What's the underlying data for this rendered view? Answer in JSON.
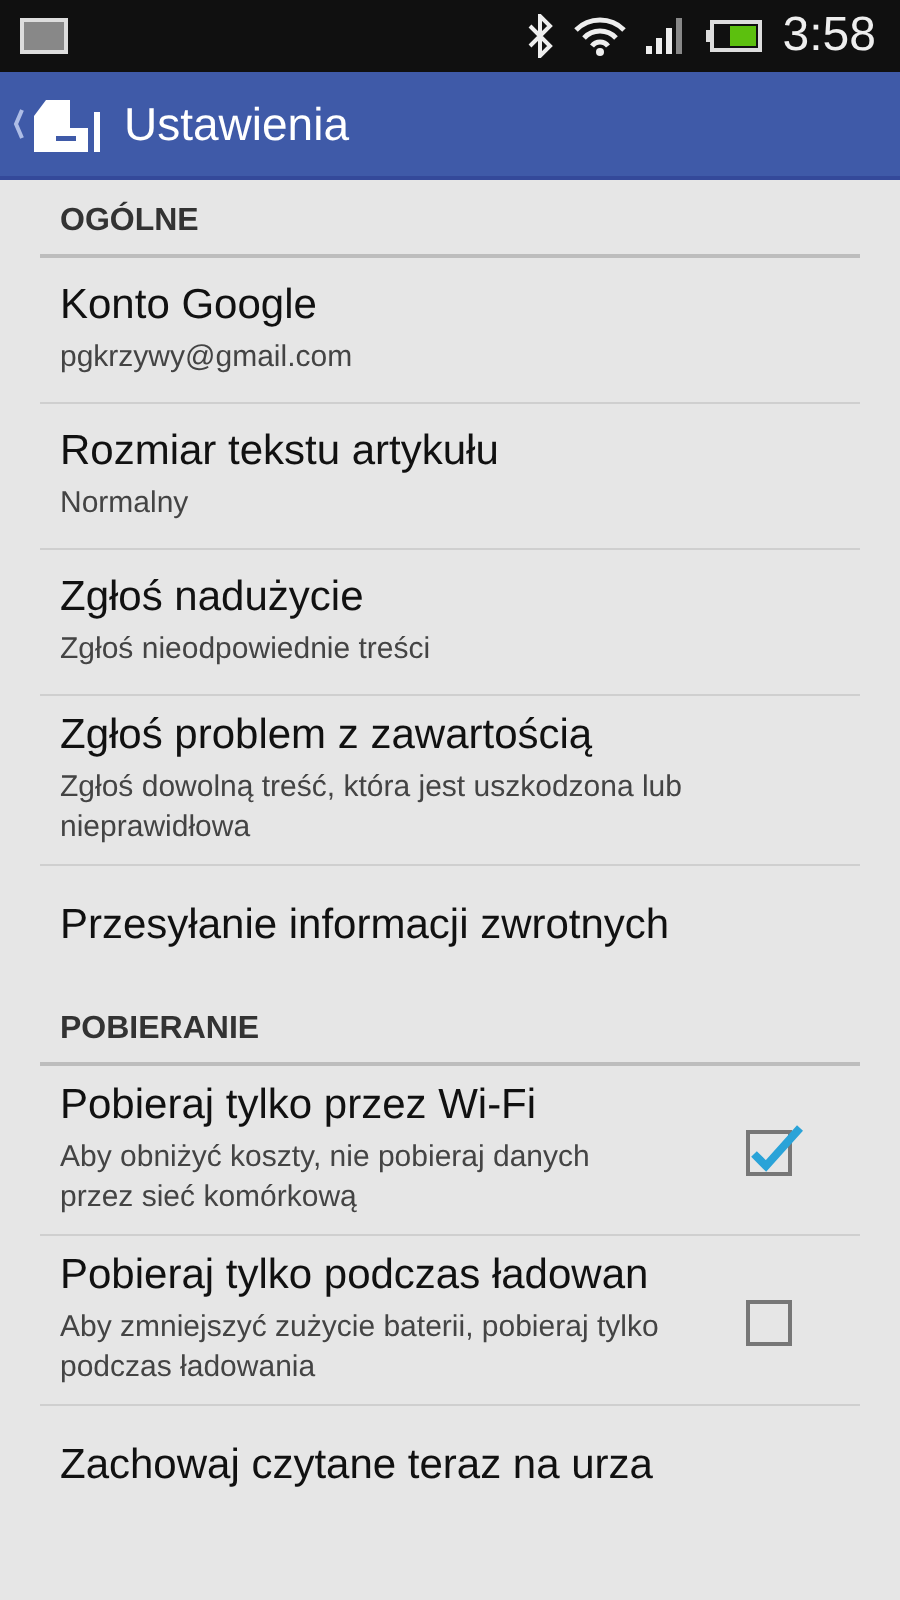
{
  "status_bar": {
    "time": "3:58"
  },
  "app_bar": {
    "title": "Ustawienia"
  },
  "sections": [
    {
      "title": "OGÓLNE",
      "items": [
        {
          "kind": "plain",
          "title": "Konto Google",
          "summary": "pgkrzywy@gmail.com"
        },
        {
          "kind": "plain",
          "title": "Rozmiar tekstu artykułu",
          "summary": "Normalny"
        },
        {
          "kind": "plain",
          "title": "Zgłoś nadużycie",
          "summary": "Zgłoś nieodpowiednie treści"
        },
        {
          "kind": "plain",
          "title": "Zgłoś problem z zawartością",
          "summary": "Zgłoś dowolną treść, która jest uszkodzona lub nieprawidłowa"
        },
        {
          "kind": "plain",
          "title": "Przesyłanie informacji zwrotnych"
        }
      ]
    },
    {
      "title": "POBIERANIE",
      "items": [
        {
          "kind": "checkbox",
          "title": "Pobieraj tylko przez Wi-Fi",
          "summary": "Aby obniżyć koszty, nie pobieraj danych przez sieć komórkową",
          "checked": true
        },
        {
          "kind": "checkbox",
          "title": "Pobieraj tylko podczas ładowan",
          "summary": "Aby zmniejszyć zużycie baterii, pobieraj tylko podczas ładowania",
          "checked": false
        },
        {
          "kind": "plain",
          "title": "Zachowaj czytane teraz na urza"
        }
      ]
    }
  ]
}
